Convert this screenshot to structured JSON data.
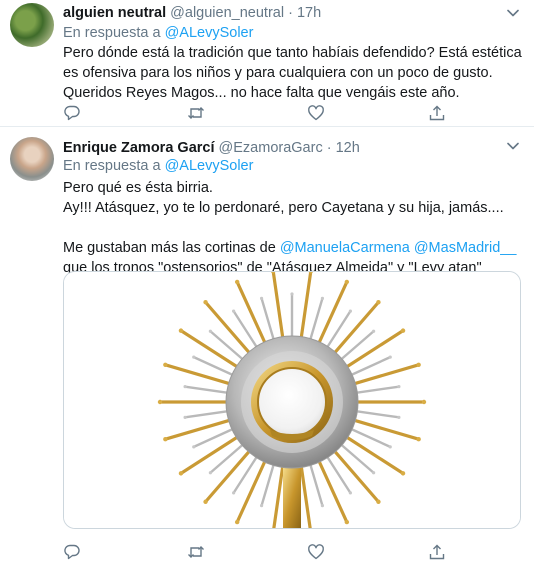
{
  "tweets": [
    {
      "name": "alguien neutral",
      "handle": "@alguien_neutral",
      "separator": "·",
      "time": "17h",
      "reply_prefix": "En respuesta a",
      "reply_handle": "@ALevySoler",
      "avatar_icon": "profile-avatar",
      "body_lines": [
        "Pero dónde está la tradición que tanto habíais defendido? Está estética es ofensiva para los niños y para cualquiera con un poco de gusto. Queridos Reyes Magos... no hace falta que vengáis este año."
      ]
    },
    {
      "name": "Enrique Zamora Garcí",
      "handle": "@EzamoraGarc",
      "separator": "·",
      "time": "12h",
      "reply_prefix": "En respuesta a",
      "reply_handle": "@ALevySoler",
      "avatar_icon": "profile-avatar",
      "body_line1": "Pero qué es ésta birria.",
      "body_line2": "Ay!!! Atásquez, yo te lo perdonaré, pero Cayetana y su hija, jamás....",
      "body_line3_prefix": "Me gustaban más las cortinas de",
      "body_line3_mention1": "@ManuelaCarmena",
      "body_line3_mention2": "@MasMadrid__",
      "body_line3_suffix": "que los tronos \"ostensorios\" de \"Atásquez Almeida\" y \"Levy atan\"",
      "media_icon": "monstrance-image"
    }
  ],
  "actions": {
    "icons": [
      "reply-icon",
      "retweet-icon",
      "like-icon",
      "share-icon"
    ]
  },
  "colors": {
    "accent": "#1da1f2",
    "secondary_text": "#657786",
    "divider": "#e6ecf0"
  }
}
